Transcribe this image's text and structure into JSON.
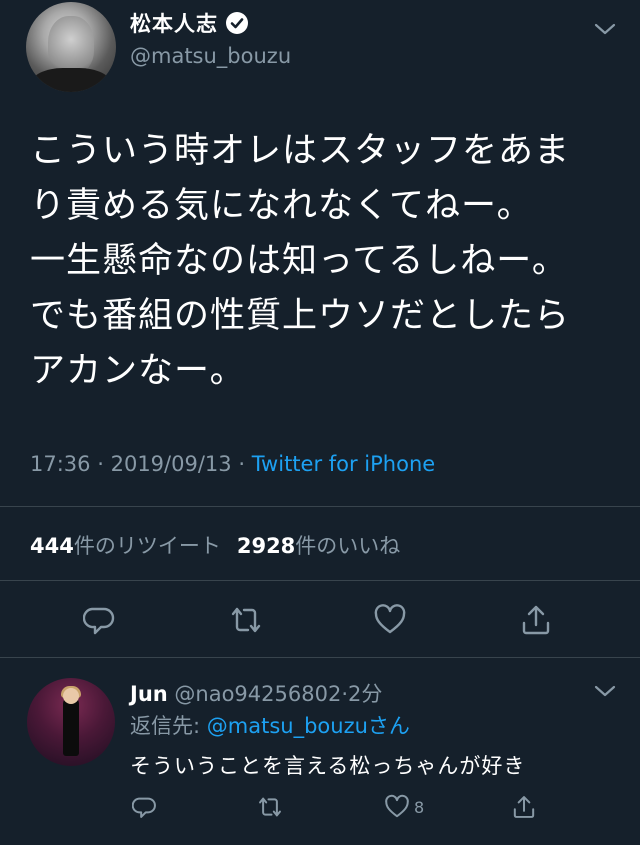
{
  "tweet": {
    "display_name": "松本人志",
    "handle": "@matsu_bouzu",
    "text": "こういう時オレはスタッフをあま\nり責める気になれなくてねー。\n一生懸命なのは知ってるしねー。\nでも番組の性質上ウソだとしたら\nアカンなー。",
    "time": "17:36",
    "date": "2019/09/13",
    "separator": "·",
    "source": "Twitter for iPhone",
    "retweet_count": "444",
    "retweet_label": "件のリツイート",
    "like_count": "2928",
    "like_label": "件のいいね"
  },
  "icons": {
    "verified": "verified-badge-icon",
    "menu": "chevron-down-icon",
    "reply": "reply-bubble-icon",
    "retweet": "retweet-arrows-icon",
    "like": "heart-icon",
    "share": "share-upload-icon"
  },
  "reply": {
    "name": "Jun",
    "handle": "@nao94256802",
    "separator": "·",
    "time": "2分",
    "replying_prefix": "返信先: ",
    "replying_handle": "@matsu_bouzu",
    "replying_suffix": "さん",
    "text": "そういうことを言える松っちゃんが好き",
    "like_count": "8"
  },
  "colors": {
    "background": "#15202b",
    "text": "#ffffff",
    "muted": "#8899a6",
    "accent": "#1da1f2",
    "divider": "#38444d"
  }
}
